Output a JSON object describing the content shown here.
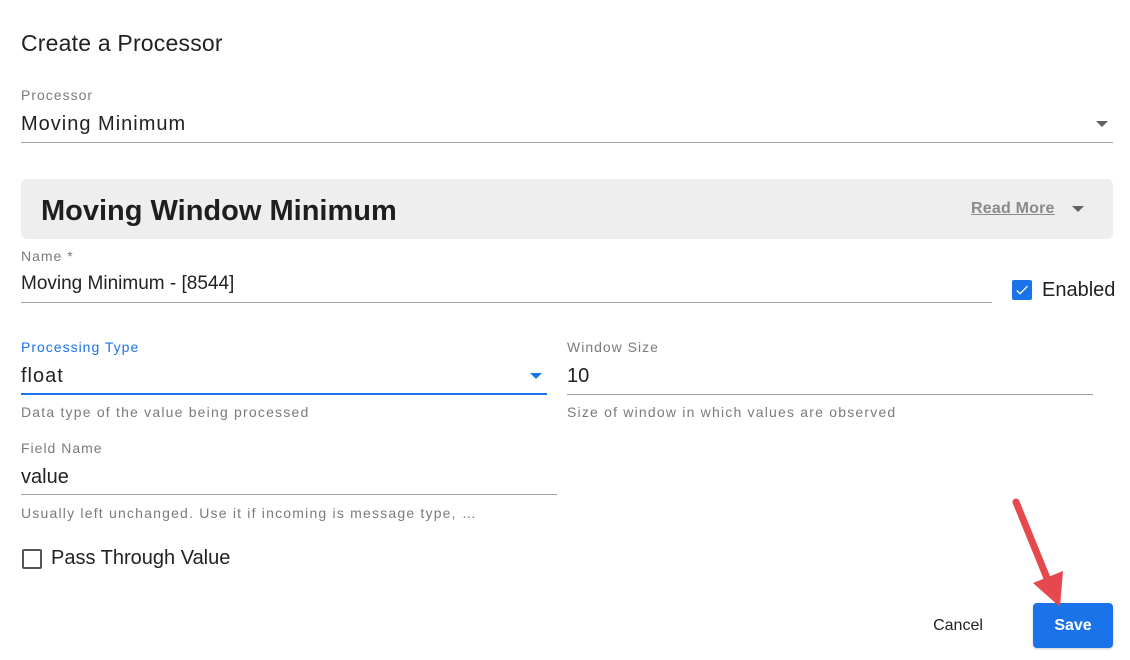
{
  "dialog": {
    "title": "Create a Processor"
  },
  "processor": {
    "label": "Processor",
    "value": "Moving Minimum"
  },
  "panel": {
    "title": "Moving Window Minimum",
    "read_more": "Read More"
  },
  "name_field": {
    "label": "Name *",
    "value": "Moving Minimum  - [8544]"
  },
  "enabled": {
    "label": "Enabled",
    "checked": true
  },
  "processing_type": {
    "label": "Processing Type",
    "value": "float",
    "helper": "Data type of the value being processed"
  },
  "window_size": {
    "label": "Window Size",
    "value": "10",
    "helper": "Size of window in which values are observed"
  },
  "field_name": {
    "label": "Field Name",
    "value": "value",
    "helper": "Usually left unchanged. Use it if incoming is message type, …"
  },
  "pass_through": {
    "label": "Pass Through Value",
    "checked": false
  },
  "buttons": {
    "cancel": "Cancel",
    "save": "Save"
  },
  "colors": {
    "primary": "#1a73e8",
    "annotation_arrow": "#e5484d"
  },
  "icons": {
    "dropdown": "caret-down-icon",
    "check": "check-icon",
    "arrow": "red-arrow-annotation"
  }
}
